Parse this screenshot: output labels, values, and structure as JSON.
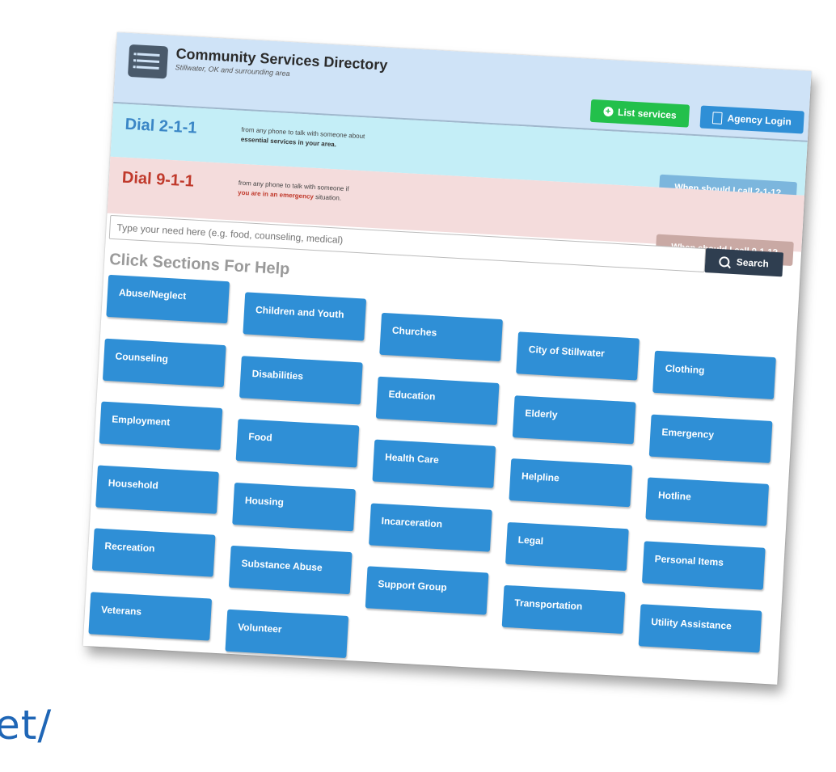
{
  "header": {
    "title": "Community Services Directory",
    "subtitle": "Stillwater, OK and surrounding area",
    "list_services": "List services",
    "agency_login": "Agency Login"
  },
  "dial211": {
    "title": "Dial 2-1-1",
    "text": "from any phone to talk with someone about",
    "text_bold": "essential services in your area.",
    "when": "When should I call 2-1-1?"
  },
  "dial911": {
    "title": "Dial 9-1-1",
    "text": "from any phone to talk with someone if",
    "text_bold": "you are in an emergency",
    "text_tail": "situation.",
    "when": "When should I call 9-1-1?"
  },
  "search": {
    "placeholder": "Type your need here (e.g. food, counseling, medical)",
    "button": "Search"
  },
  "sections": {
    "heading": "Click Sections For Help",
    "items": [
      "Abuse/Neglect",
      "Children and Youth",
      "Churches",
      "City of Stillwater",
      "Clothing",
      "Counseling",
      "Disabilities",
      "Education",
      "Elderly",
      "Emergency",
      "Employment",
      "Food",
      "Health Care",
      "Helpline",
      "Hotline",
      "Household",
      "Housing",
      "Incarceration",
      "Legal",
      "Personal Items",
      "Recreation",
      "Substance Abuse",
      "Support Group",
      "Transportation",
      "Utility Assistance",
      "Veterans",
      "Volunteer"
    ]
  },
  "url_fragment": "et/",
  "colors": {
    "header_bg": "#cfe3f7",
    "band_211": "#c4eef7",
    "band_911": "#f4dcdc",
    "category_button": "#2f8fd6",
    "list_button": "#23c04b",
    "search_button": "#2f3e50"
  }
}
